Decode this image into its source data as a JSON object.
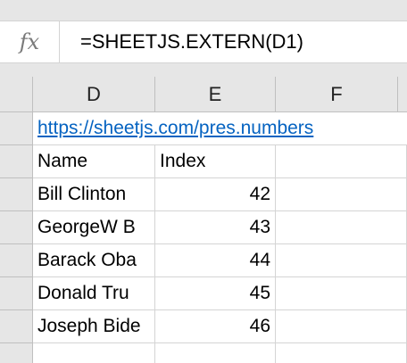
{
  "formula_bar": {
    "fx_label": "fx",
    "formula": "=SHEETJS.EXTERN(D1)"
  },
  "columns": [
    "D",
    "E",
    "F"
  ],
  "cells": {
    "D1": "https://sheetjs.com/pres.numbers",
    "D2": "Name",
    "E2": "Index",
    "D3": "Bill Clinton",
    "E3": "42",
    "D4": "GeorgeW B",
    "E4": "43",
    "D5": "Barack Oba",
    "E5": "44",
    "D6": "Donald Tru",
    "E6": "45",
    "D7": "Joseph Bide",
    "E7": "46",
    "D8": "",
    "E8": ""
  },
  "colors": {
    "link": "#0563c1",
    "header_bg": "#e6e6e6",
    "gridline": "#d4d4d4"
  }
}
